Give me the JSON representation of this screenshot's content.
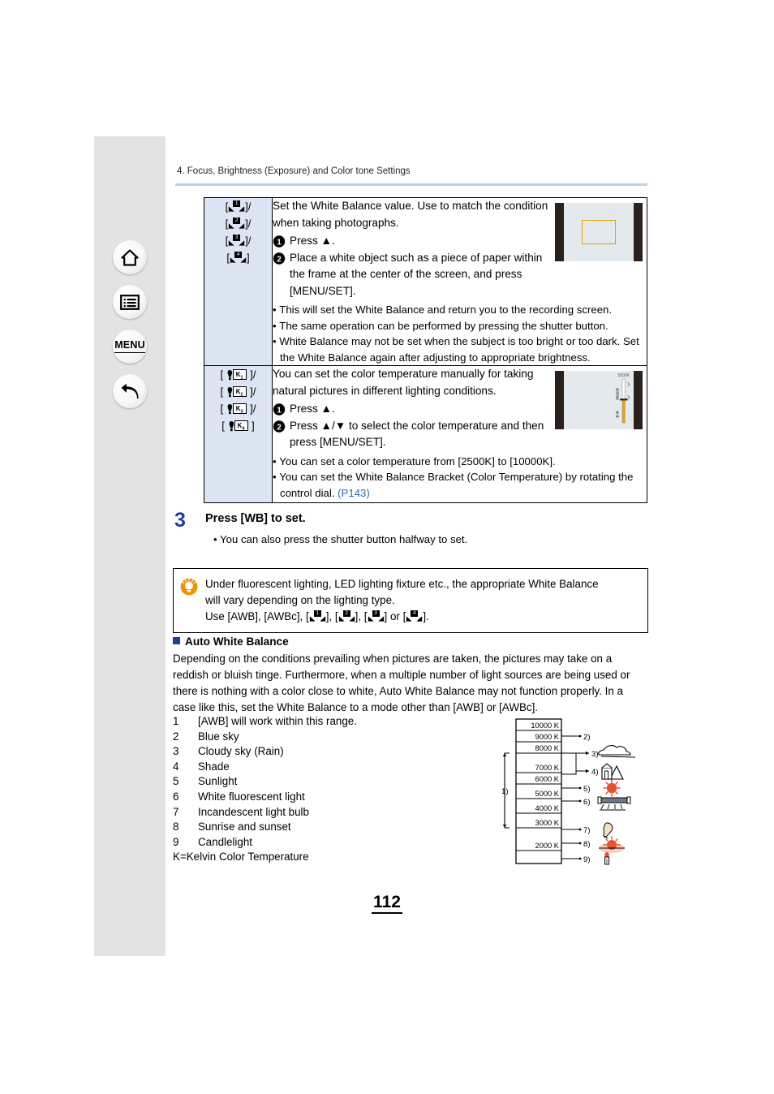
{
  "running_head": "4. Focus, Brightness (Exposure) and Color tone Settings",
  "sidebar": {
    "buttons": [
      {
        "name": "home-icon",
        "label": ""
      },
      {
        "name": "contents-icon",
        "label": ""
      },
      {
        "name": "menu-button",
        "label": "MENU"
      },
      {
        "name": "back-icon",
        "label": ""
      }
    ]
  },
  "table": {
    "rows": [
      {
        "icons": [
          "[ 1 ]/",
          "[ 2 ]/",
          "[ 3 ]/",
          "[ 4 ]"
        ],
        "intro": "Set the White Balance value. Use to match the condition when taking photographs.",
        "steps": [
          "Press ▲.",
          "Place a white object such as a piece of paper within the frame at the center of the screen, and press [MENU/SET]."
        ],
        "bullets": [
          "This will set the White Balance and return you to the recording screen.",
          "The same operation can be performed by pressing the shutter button.",
          "White Balance may not be set when the subject is too bright or too dark. Set the White Balance again after adjusting to appropriate brightness."
        ],
        "screenshot": "white-set-frame-screen"
      },
      {
        "icons": [
          "[ K1 ]/",
          "[ K2 ]/",
          "[ K3 ]/",
          "[ K4 ]"
        ],
        "intro": "You can set the color temperature manually for taking natural pictures in different lighting conditions.",
        "steps": [
          "Press ▲.",
          "Press ▲/▼ to select the color temperature and then press [MENU/SET]."
        ],
        "bullets": [
          "You can set a color temperature from [2500K] to [10000K].",
          "You can set the White Balance Bracket (Color Temperature) by rotating the control dial."
        ],
        "page_ref": "(P143)",
        "screenshot": "color-temperature-screen",
        "osd_value": "5500K"
      }
    ]
  },
  "step3": {
    "number": "3",
    "heading_before": "Press [",
    "heading_key": "WB",
    "heading_after": "] to set.",
    "bullet": "• You can also press the shutter button halfway to set."
  },
  "tip": {
    "icon": "lightbulb-icon",
    "line1": "Under fluorescent lighting, LED lighting fixture etc., the appropriate White Balance",
    "line2": "will vary depending on the lighting type.",
    "line3_prefix": "Use [AWB], [AWBc], [",
    "line3_parts": [
      "], [",
      "], [",
      "] or [",
      "]."
    ]
  },
  "awb_section": {
    "heading": "Auto White Balance",
    "paragraph": "Depending on the conditions prevailing when pictures are taken, the pictures may take on a reddish or bluish tinge. Furthermore, when a multiple number of light sources are being used or there is nothing with a color close to white, Auto White Balance may not function properly. In a case like this, set the White Balance to a mode other than [AWB] or [AWBc]."
  },
  "legend": {
    "items": [
      {
        "num": "1",
        "text": "[AWB] will work within this range."
      },
      {
        "num": "2",
        "text": "Blue sky"
      },
      {
        "num": "3",
        "text": "Cloudy sky (Rain)"
      },
      {
        "num": "4",
        "text": "Shade"
      },
      {
        "num": "5",
        "text": "Sunlight"
      },
      {
        "num": "6",
        "text": "White fluorescent light"
      },
      {
        "num": "7",
        "text": "Incandescent light bulb"
      },
      {
        "num": "8",
        "text": "Sunrise and sunset"
      },
      {
        "num": "9",
        "text": "Candlelight"
      }
    ],
    "kelvin_note": "K=Kelvin Color Temperature"
  },
  "kelvin_diagram": {
    "scale_labels": [
      "10000 K",
      "9000 K",
      "8000 K",
      "7000 K",
      "6000 K",
      "5000 K",
      "4000 K",
      "3000 K",
      "2000 K"
    ],
    "callouts": [
      "1)",
      "2)",
      "3)",
      "4)",
      "5)",
      "6)",
      "7)",
      "8)",
      "9)"
    ],
    "range_label": "1)"
  },
  "page_number": "112",
  "colors": {
    "accent_blue": "#1f3f9e",
    "link_blue": "#2f64bf",
    "rule_blue": "#b9d2ea",
    "cell_blue": "#dde5f2",
    "tip_orange": "#f29100",
    "focus_orange": "#e8a200",
    "sidebar_grey": "#e3e3e3"
  }
}
